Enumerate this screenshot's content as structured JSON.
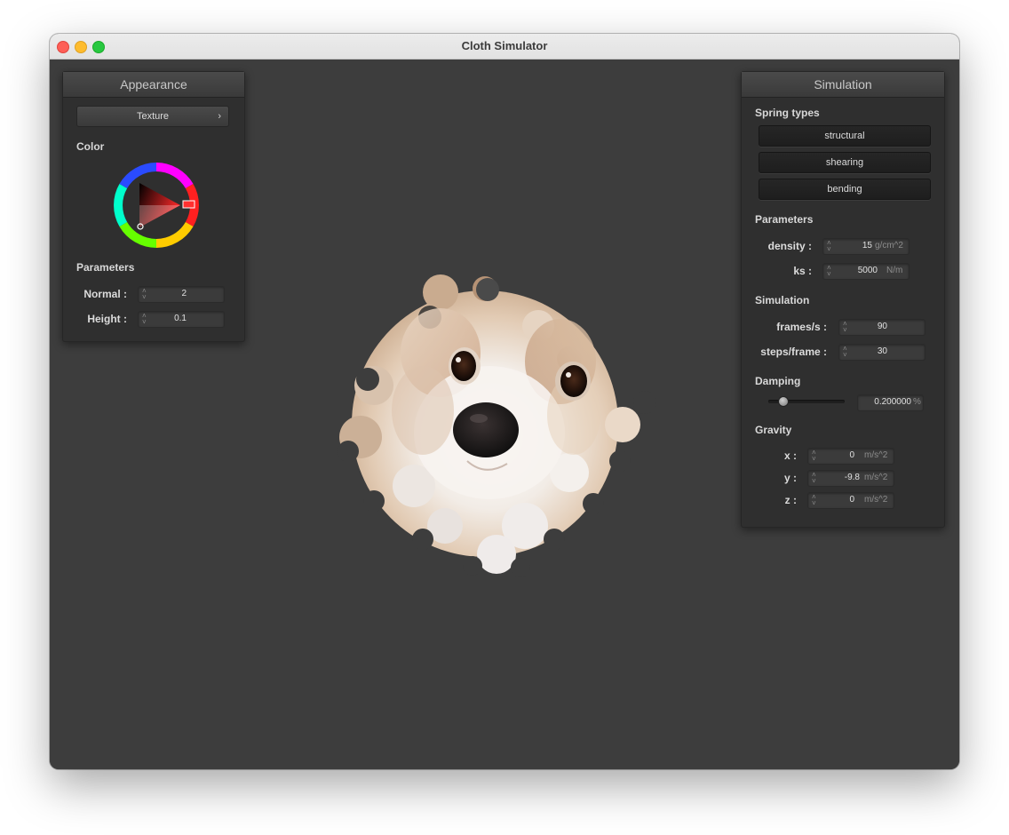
{
  "window": {
    "title": "Cloth Simulator"
  },
  "appearance": {
    "header": "Appearance",
    "shader_select": "Texture",
    "color_label": "Color",
    "color_value": "#ff2a2a",
    "params_label": "Parameters",
    "normal_label": "Normal :",
    "normal_value": "2",
    "height_label": "Height :",
    "height_value": "0.1"
  },
  "simulation": {
    "header": "Simulation",
    "spring_types_label": "Spring types",
    "spring_buttons": [
      "structural",
      "shearing",
      "bending"
    ],
    "parameters_label": "Parameters",
    "density_label": "density :",
    "density_value": "15",
    "density_unit": "g/cm^2",
    "ks_label": "ks :",
    "ks_value": "5000",
    "ks_unit": "N/m",
    "simulation_label": "Simulation",
    "fps_label": "frames/s :",
    "fps_value": "90",
    "steps_label": "steps/frame :",
    "steps_value": "30",
    "damping_label": "Damping",
    "damping_value": "0.200000",
    "damping_unit": "%",
    "damping_level": 0.2,
    "gravity_label": "Gravity",
    "gx_label": "x :",
    "gx_value": "0",
    "gy_label": "y :",
    "gy_value": "-9.8",
    "gz_label": "z :",
    "gz_value": "0",
    "gravity_unit": "m/s^2"
  }
}
